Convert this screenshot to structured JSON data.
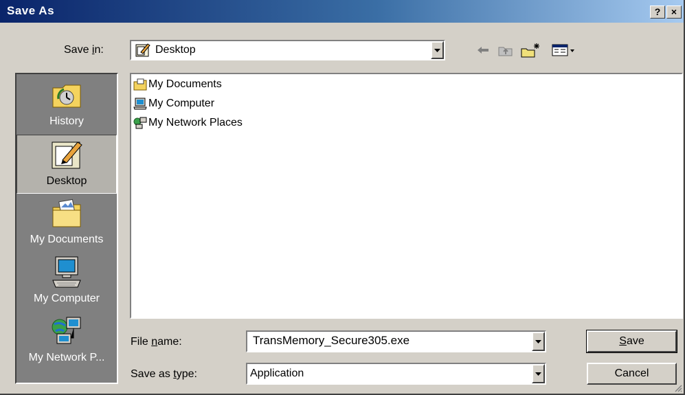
{
  "window": {
    "title": "Save As",
    "help_label": "?",
    "close_label": "×"
  },
  "save_in": {
    "label_pre": "Save ",
    "label_key": "i",
    "label_post": "n:",
    "value": "Desktop"
  },
  "toolbar": [
    {
      "name": "back-icon"
    },
    {
      "name": "up-folder-icon"
    },
    {
      "name": "new-folder-icon"
    },
    {
      "name": "view-menu-icon"
    }
  ],
  "places": [
    {
      "label": "History",
      "icon": "history-icon",
      "selected": false
    },
    {
      "label": "Desktop",
      "icon": "desktop-icon",
      "selected": true
    },
    {
      "label": "My Documents",
      "icon": "my-documents-icon",
      "selected": false
    },
    {
      "label": "My Computer",
      "icon": "my-computer-icon",
      "selected": false
    },
    {
      "label": "My Network P...",
      "icon": "my-network-places-icon",
      "selected": false
    }
  ],
  "files": [
    {
      "name": "My Documents",
      "icon": "my-documents-icon"
    },
    {
      "name": "My Computer",
      "icon": "my-computer-icon"
    },
    {
      "name": "My Network Places",
      "icon": "my-network-places-icon"
    }
  ],
  "file_name": {
    "label_pre": "File ",
    "label_key": "n",
    "label_post": "ame:",
    "value": "TransMemory_Secure305.exe"
  },
  "save_type": {
    "label_pre": "Save as ",
    "label_key": "t",
    "label_post": "ype:",
    "value": "Application"
  },
  "buttons": {
    "save_key": "S",
    "save_rest": "ave",
    "cancel": "Cancel"
  }
}
